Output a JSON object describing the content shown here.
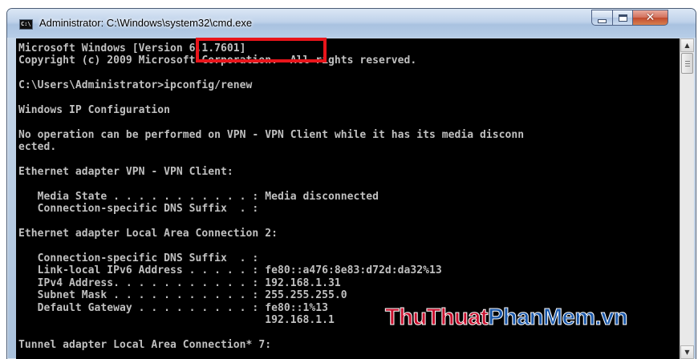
{
  "window": {
    "title": "Administrator: C:\\Windows\\system32\\cmd.exe",
    "icon_label": "C:\\"
  },
  "controls": {
    "minimize": "minimize-icon",
    "maximize": "maximize-icon",
    "close": "close-icon",
    "close_glyph": "✕"
  },
  "console": {
    "lines": [
      "Microsoft Windows [Version 6.1.7601]",
      "Copyright (c) 2009 Microsoft Corporation.  All rights reserved.",
      "",
      "C:\\Users\\Administrator>ipconfig/renew",
      "",
      "Windows IP Configuration",
      "",
      "No operation can be performed on VPN - VPN Client while it has its media disconn",
      "ected.",
      "",
      "Ethernet adapter VPN - VPN Client:",
      "",
      "   Media State . . . . . . . . . . . : Media disconnected",
      "   Connection-specific DNS Suffix  . :",
      "",
      "Ethernet adapter Local Area Connection 2:",
      "",
      "   Connection-specific DNS Suffix  . :",
      "   Link-local IPv6 Address . . . . . : fe80::a476:8e83:d72d:da32%13",
      "   IPv4 Address. . . . . . . . . . . : 192.168.1.31",
      "   Subnet Mask . . . . . . . . . . . : 255.255.255.0",
      "   Default Gateway . . . . . . . . . : fe80::1%13",
      "                                       192.168.1.1",
      "",
      "Tunnel adapter Local Area Connection* 7:"
    ],
    "highlighted_command": "ipconfig/renew"
  },
  "scrollbar": {
    "up_arrow": "▲",
    "down_arrow": "▼"
  },
  "watermark": {
    "part1": "ThuThuat",
    "part2": "PhanMem",
    "part3": ".vn"
  },
  "colors": {
    "console_bg": "#000000",
    "console_text": "#c0c0c0",
    "highlight_border": "#e8151b",
    "watermark_red": "#c8102e",
    "watermark_blue": "#1856a8"
  }
}
